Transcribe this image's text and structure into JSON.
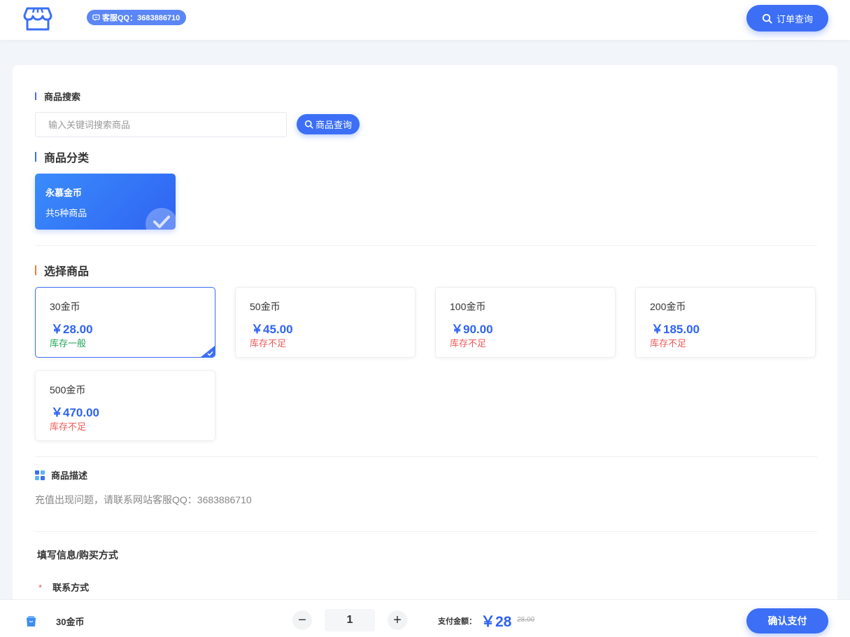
{
  "header": {
    "qq_badge": "客服QQ：3683886710",
    "order_query_label": "订单查询"
  },
  "search": {
    "title": "商品搜索",
    "placeholder": "输入关键词搜索商品",
    "button_label": "商品查询"
  },
  "category": {
    "title": "商品分类",
    "items": [
      {
        "name": "永慕金币",
        "count": "共5种商品",
        "selected": true
      }
    ]
  },
  "products": {
    "title": "选择商品",
    "items": [
      {
        "name": "30金币",
        "price": "￥28.00",
        "stock": "库存一般",
        "stock_status": "ok",
        "selected": true
      },
      {
        "name": "50金币",
        "price": "￥45.00",
        "stock": "库存不足",
        "stock_status": "low",
        "selected": false
      },
      {
        "name": "100金币",
        "price": "￥90.00",
        "stock": "库存不足",
        "stock_status": "low",
        "selected": false
      },
      {
        "name": "200金币",
        "price": "￥185.00",
        "stock": "库存不足",
        "stock_status": "low",
        "selected": false
      },
      {
        "name": "500金币",
        "price": "￥470.00",
        "stock": "库存不足",
        "stock_status": "low",
        "selected": false
      }
    ]
  },
  "description": {
    "title": "商品描述",
    "text": "充值出现问题，请联系网站客服QQ：3683886710"
  },
  "form": {
    "title": "填写信息/购买方式",
    "contact_required": "*",
    "contact_label": "联系方式"
  },
  "footer": {
    "selected_name": "30金币",
    "quantity": "1",
    "minus": "−",
    "plus": "+",
    "pay_label": "支付金额：",
    "pay_amount": "￥28",
    "original_price": "28.00",
    "pay_button": "确认支付"
  },
  "colors": {
    "primary": "#3c6ff5",
    "accent_orange": "#f5792a",
    "stock_ok": "#23a55a",
    "stock_low": "#ef5a5a"
  }
}
